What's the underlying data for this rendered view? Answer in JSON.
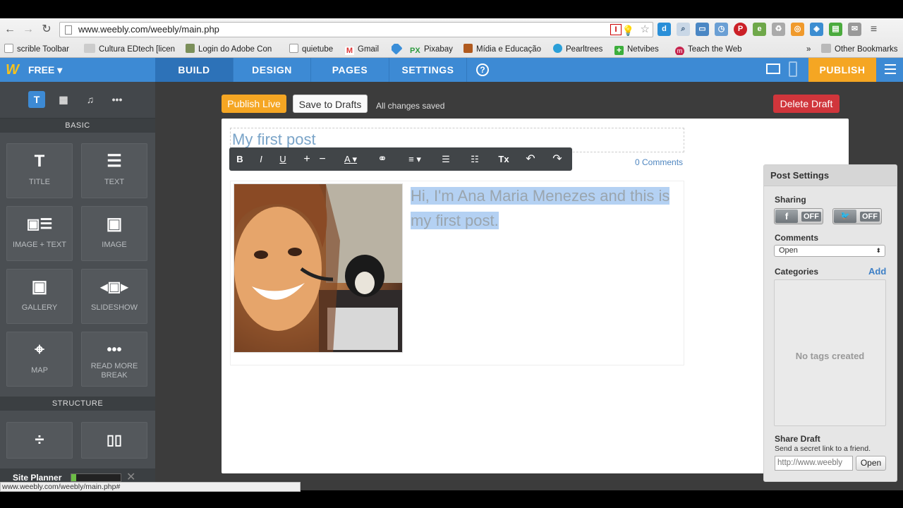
{
  "browser": {
    "url": "www.weebly.com/weebly/main.php",
    "bookmarks": [
      "scrible Toolbar",
      "Cultura EDtech [licen",
      "Login do Adobe Con",
      "quietube",
      "Gmail",
      "Pixabay",
      "Mídia e Educação",
      "Pearltrees",
      "Netvibes",
      "Teach the Web",
      "»",
      "Other Bookmarks"
    ],
    "status_url": "www.weebly.com/weebly/main.php#"
  },
  "appbar": {
    "logo": "W",
    "plan": "FREE ▾",
    "tabs": [
      "BUILD",
      "DESIGN",
      "PAGES",
      "SETTINGS"
    ],
    "help": "?",
    "publish": "PUBLISH",
    "colors": {
      "bar": "#3d8ad4",
      "publish": "#f5a623"
    }
  },
  "sidebar": {
    "tools": [
      "T",
      "▦",
      "♫",
      "•••"
    ],
    "basic_heading": "BASIC",
    "elements": [
      {
        "icon": "T",
        "label": "TITLE"
      },
      {
        "icon": "☰",
        "label": "TEXT"
      },
      {
        "icon": "▣☰",
        "label": "IMAGE + TEXT"
      },
      {
        "icon": "▣",
        "label": "IMAGE"
      },
      {
        "icon": "▣",
        "label": "GALLERY"
      },
      {
        "icon": "◂▣▸",
        "label": "SLIDESHOW"
      },
      {
        "icon": "⌖",
        "label": "MAP"
      },
      {
        "icon": "•••",
        "label": "READ MORE BREAK"
      }
    ],
    "structure_heading": "STRUCTURE",
    "structure": [
      {
        "icon": "÷"
      },
      {
        "icon": "▯▯"
      }
    ],
    "site_planner": "Site Planner",
    "site_planner_progress": 0.1
  },
  "editor": {
    "publish_live": "Publish Live",
    "save_drafts": "Save to Drafts",
    "saved_status": "All changes saved",
    "delete_draft": "Delete Draft",
    "post_title": "My first post",
    "comments": "0 Comments",
    "text_toolbar": [
      "B",
      "I",
      "U",
      "+",
      "−",
      "A ▾",
      "⚭",
      "≡ ▾",
      "☰",
      "☷",
      "Tx",
      "↶",
      "↷"
    ],
    "post_text": "Hi, I'm Ana Maria Menezes and this is my first post."
  },
  "post_settings": {
    "title": "Post Settings",
    "sharing": "Sharing",
    "facebook": {
      "icon": "f",
      "state": "OFF"
    },
    "twitter": {
      "icon": "🐦",
      "state": "OFF"
    },
    "comments_label": "Comments",
    "comments_value": "Open",
    "categories": "Categories",
    "add": "Add",
    "no_tags": "No tags created",
    "share_draft": "Share Draft",
    "share_desc": "Send a secret link to a friend.",
    "share_input": "http://www.weebly",
    "open": "Open"
  }
}
